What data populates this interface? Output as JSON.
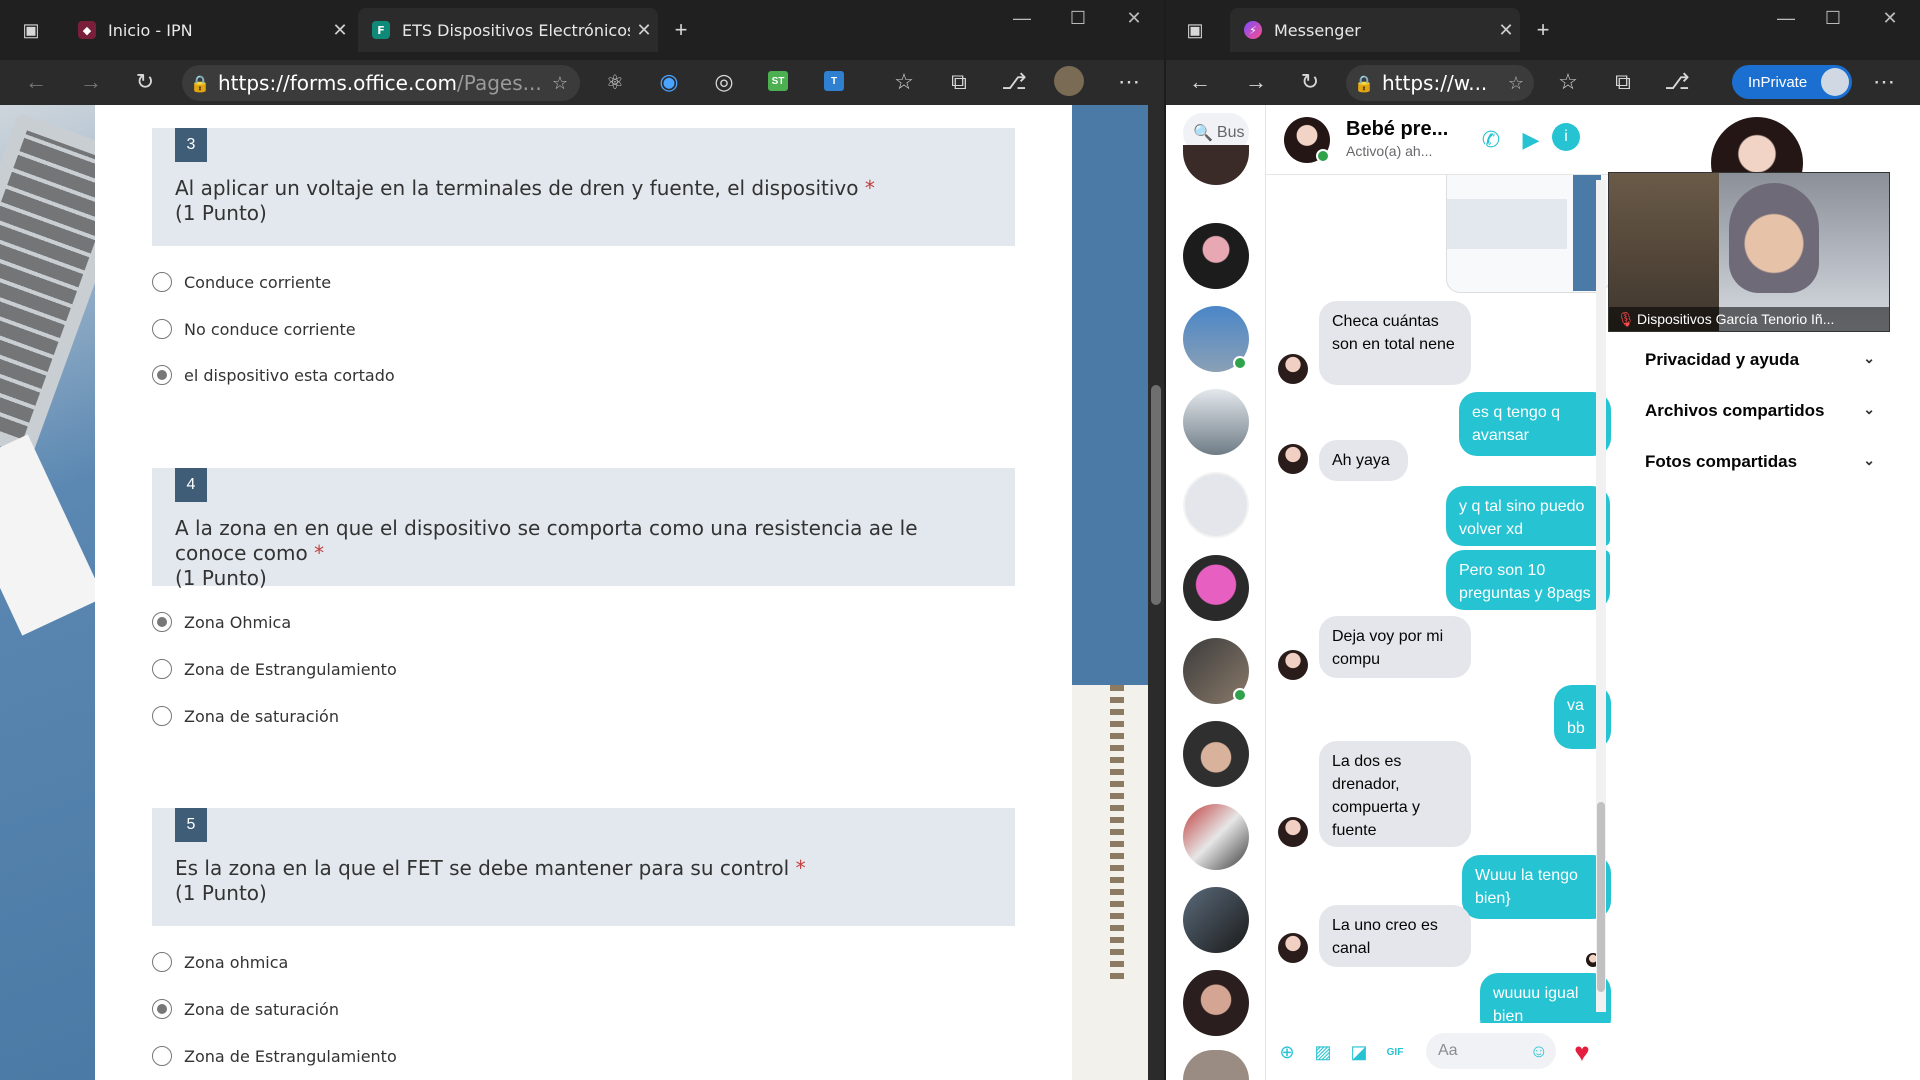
{
  "left_browser": {
    "tabs": [
      {
        "title": "Inicio - IPN",
        "active": false
      },
      {
        "title": "ETS Dispositivos Electrónicos",
        "active": true
      }
    ],
    "new_tab": "+",
    "address": {
      "url_main": "https://forms.office.com",
      "url_dim": "/Pages..."
    },
    "extensions": [
      "ST",
      "T"
    ]
  },
  "form": {
    "questions": [
      {
        "number": "3",
        "text": "Al aplicar un voltaje en la terminales de dren y fuente, el dispositivo",
        "required": "*",
        "points": "(1 Punto)",
        "options": [
          "Conduce corriente",
          "No conduce corriente",
          "el dispositivo esta cortado"
        ],
        "selected_index": 2
      },
      {
        "number": "4",
        "text": "A la zona en en que el dispositivo se comporta como una resistencia ae le conoce como",
        "required": "*",
        "points": "(1 Punto)",
        "options": [
          "Zona Ohmica",
          "Zona de Estrangulamiento",
          "Zona de saturación"
        ],
        "selected_index": 0
      },
      {
        "number": "5",
        "text": "Es la zona en la que el FET se debe mantener para su control",
        "required": "*",
        "points": "(1 Punto)",
        "options": [
          "Zona ohmica",
          "Zona de saturación",
          "Zona de Estrangulamiento"
        ],
        "selected_index": 1
      }
    ]
  },
  "right_browser": {
    "tab": {
      "title": "Messenger"
    },
    "address": {
      "url": "https://w..."
    },
    "inprivate_label": "InPrivate"
  },
  "messenger": {
    "search_placeholder": "Bus",
    "contact": {
      "name": "Bebé pre...",
      "status": "Activo(a) ah..."
    },
    "messages": [
      {
        "dir": "in",
        "text": "Checa cuántas son en total nene"
      },
      {
        "dir": "out",
        "text": "es q tengo q avansar"
      },
      {
        "dir": "in",
        "text": "Ah yaya"
      },
      {
        "dir": "out",
        "text": "y q tal sino puedo volver xd"
      },
      {
        "dir": "out",
        "text": "Pero son 10 preguntas y 8pags"
      },
      {
        "dir": "in",
        "text": "Deja voy por mi compu"
      },
      {
        "dir": "out",
        "text": "va bb"
      },
      {
        "dir": "in",
        "text": "La dos es drenador, compuerta y fuente"
      },
      {
        "dir": "out",
        "text": "Wuuu la tengo bien}"
      },
      {
        "dir": "in",
        "text": "La uno creo es canal"
      },
      {
        "dir": "out",
        "text": "wuuuu igual bien"
      }
    ],
    "composer_placeholder": "Aa",
    "gif_label": "GIF",
    "info_sections": [
      "Privacidad y ayuda",
      "Archivos compartidos",
      "Fotos compartidas"
    ]
  },
  "video_overlay": {
    "caption": "Dispositivos García Tenorio Iñ..."
  },
  "colors": {
    "messenger_accent": "#26c3d3",
    "form_header": "#e2e8ed",
    "question_badge": "#3f5d77",
    "required_star": "#c43e3e"
  }
}
